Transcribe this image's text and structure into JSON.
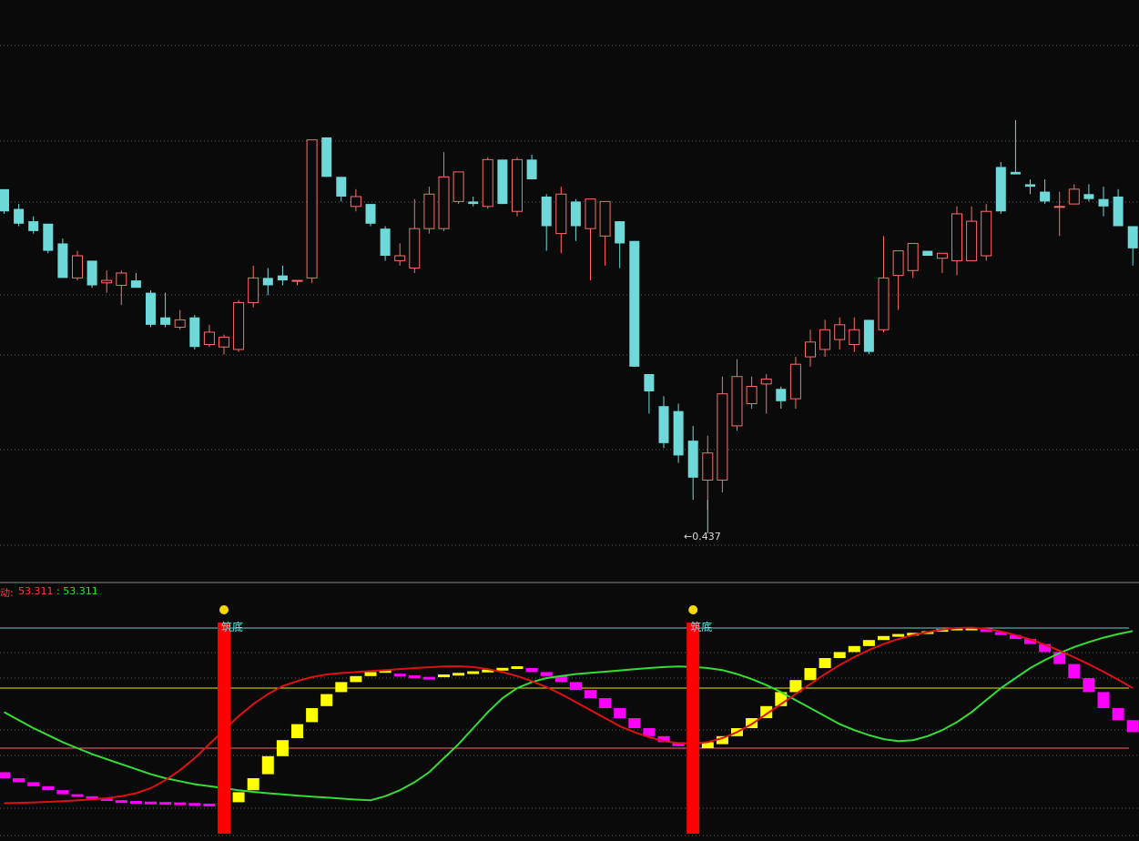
{
  "colors": {
    "background": "#0a0a0a",
    "up_candle": "#ff6b6b",
    "down_candle": "#6fd9d9",
    "grid": "#5a5a5a",
    "panel_separator": "#8a8a8a",
    "slow_line": "#33dd33",
    "fast_line": "#dd1111",
    "bar_rising": "#ffff00",
    "bar_falling": "#ff00ff",
    "signal_bar": "#ff0000",
    "signal_dot": "#ffd700",
    "signal_text": "#66e0e0",
    "ref_top": "#66cccc",
    "ref_mid": "#e6e600",
    "ref_low": "#ff6666"
  },
  "indicator": {
    "name": "动",
    "name_suffix": ":",
    "value_red": "53.311",
    "value_green": "53.311"
  },
  "price_annotation": {
    "min_label": "←0.437"
  },
  "signal_text": "筑底",
  "chart_data": [
    {
      "type": "candlestick",
      "x": [
        "c1",
        "c2",
        "c3",
        "c4",
        "c5",
        "c6",
        "c7",
        "c8",
        "c9",
        "c10",
        "c11",
        "c12",
        "c13",
        "c14",
        "c15",
        "c16",
        "c17",
        "c18",
        "c19",
        "c20",
        "c21",
        "c22",
        "c23",
        "c24",
        "c25",
        "c26",
        "c27",
        "c28",
        "c29",
        "c30",
        "c31",
        "c32",
        "c33",
        "c34",
        "c35",
        "c36",
        "c37",
        "c38",
        "c39",
        "c40",
        "c41",
        "c42",
        "c43",
        "c44",
        "c45",
        "c46",
        "c47",
        "c48",
        "c49",
        "c50",
        "c51",
        "c52",
        "c53",
        "c54",
        "c55",
        "c56",
        "c57",
        "c58",
        "c59",
        "c60",
        "c61",
        "c62",
        "c63",
        "c64",
        "c65",
        "c66",
        "c67",
        "c68",
        "c69",
        "c70",
        "c71",
        "c72",
        "c73",
        "c74",
        "c75",
        "c76",
        "c77",
        "c78"
      ],
      "ohlc": [
        [
          0.567,
          0.567,
          0.557,
          0.558
        ],
        [
          0.559,
          0.561,
          0.552,
          0.553
        ],
        [
          0.554,
          0.556,
          0.549,
          0.55
        ],
        [
          0.553,
          0.553,
          0.541,
          0.542
        ],
        [
          0.545,
          0.547,
          0.531,
          0.531
        ],
        [
          0.531,
          0.542,
          0.53,
          0.54
        ],
        [
          0.538,
          0.538,
          0.527,
          0.528
        ],
        [
          0.529,
          0.534,
          0.525,
          0.53
        ],
        [
          0.528,
          0.534,
          0.52,
          0.533
        ],
        [
          0.53,
          0.533,
          0.527,
          0.527
        ],
        [
          0.525,
          0.526,
          0.511,
          0.512
        ],
        [
          0.515,
          0.525,
          0.511,
          0.512
        ],
        [
          0.511,
          0.518,
          0.51,
          0.514
        ],
        [
          0.515,
          0.516,
          0.502,
          0.503
        ],
        [
          0.504,
          0.512,
          0.503,
          0.509
        ],
        [
          0.503,
          0.508,
          0.5,
          0.507
        ],
        [
          0.502,
          0.522,
          0.501,
          0.521
        ],
        [
          0.521,
          0.536,
          0.519,
          0.531
        ],
        [
          0.531,
          0.535,
          0.524,
          0.528
        ],
        [
          0.532,
          0.536,
          0.528,
          0.53
        ],
        [
          0.53,
          0.53,
          0.528,
          0.53
        ],
        [
          0.531,
          0.587,
          0.529,
          0.587
        ],
        [
          0.588,
          0.588,
          0.572,
          0.572
        ],
        [
          0.572,
          0.572,
          0.562,
          0.564
        ],
        [
          0.56,
          0.567,
          0.558,
          0.564
        ],
        [
          0.561,
          0.561,
          0.552,
          0.553
        ],
        [
          0.551,
          0.552,
          0.538,
          0.54
        ],
        [
          0.538,
          0.545,
          0.536,
          0.54
        ],
        [
          0.535,
          0.563,
          0.533,
          0.551
        ],
        [
          0.551,
          0.568,
          0.549,
          0.565
        ],
        [
          0.551,
          0.582,
          0.55,
          0.572
        ],
        [
          0.562,
          0.573,
          0.561,
          0.574
        ],
        [
          0.562,
          0.564,
          0.56,
          0.561
        ],
        [
          0.56,
          0.58,
          0.559,
          0.579
        ],
        [
          0.579,
          0.579,
          0.561,
          0.561
        ],
        [
          0.558,
          0.58,
          0.556,
          0.579
        ],
        [
          0.579,
          0.581,
          0.571,
          0.571
        ],
        [
          0.564,
          0.565,
          0.542,
          0.552
        ],
        [
          0.549,
          0.568,
          0.541,
          0.565
        ],
        [
          0.562,
          0.563,
          0.546,
          0.552
        ],
        [
          0.551,
          0.56,
          0.53,
          0.563
        ],
        [
          0.548,
          0.561,
          0.536,
          0.562
        ],
        [
          0.554,
          0.554,
          0.535,
          0.545
        ],
        [
          0.546,
          0.546,
          0.496,
          0.495
        ],
        [
          0.492,
          0.486,
          0.476,
          0.485
        ],
        [
          0.479,
          0.483,
          0.462,
          0.464
        ],
        [
          0.477,
          0.48,
          0.456,
          0.459
        ],
        [
          0.465,
          0.471,
          0.441,
          0.45
        ],
        [
          0.449,
          0.467,
          0.437,
          0.46
        ],
        [
          0.449,
          0.491,
          0.444,
          0.484
        ],
        [
          0.471,
          0.498,
          0.469,
          0.491
        ],
        [
          0.48,
          0.491,
          0.478,
          0.487
        ],
        [
          0.488,
          0.492,
          0.476,
          0.49
        ],
        [
          0.486,
          0.487,
          0.478,
          0.481
        ],
        [
          0.482,
          0.499,
          0.478,
          0.496
        ],
        [
          0.499,
          0.51,
          0.495,
          0.505
        ],
        [
          0.502,
          0.514,
          0.499,
          0.51
        ],
        [
          0.506,
          0.515,
          0.502,
          0.512
        ],
        [
          0.504,
          0.515,
          0.501,
          0.51
        ],
        [
          0.514,
          0.514,
          0.5,
          0.501
        ],
        [
          0.51,
          0.548,
          0.509,
          0.531
        ],
        [
          0.532,
          0.541,
          0.518,
          0.542
        ],
        [
          0.534,
          0.545,
          0.531,
          0.545
        ],
        [
          0.542,
          0.542,
          0.54,
          0.54
        ],
        [
          0.539,
          0.541,
          0.533,
          0.541
        ],
        [
          0.538,
          0.56,
          0.532,
          0.557
        ],
        [
          0.538,
          0.56,
          0.538,
          0.554
        ],
        [
          0.54,
          0.561,
          0.538,
          0.558
        ],
        [
          0.576,
          0.578,
          0.557,
          0.558
        ],
        [
          0.574,
          0.595,
          0.573,
          0.573
        ],
        [
          0.569,
          0.571,
          0.565,
          0.568
        ],
        [
          0.566,
          0.571,
          0.561,
          0.562
        ],
        [
          0.56,
          0.566,
          0.548,
          0.56
        ],
        [
          0.561,
          0.569,
          0.561,
          0.567
        ],
        [
          0.565,
          0.569,
          0.562,
          0.563
        ],
        [
          0.563,
          0.568,
          0.556,
          0.56
        ],
        [
          0.564,
          0.567,
          0.552,
          0.552
        ],
        [
          0.552,
          0.542,
          0.536,
          0.543
        ]
      ],
      "min_price": 0.437
    },
    {
      "type": "bar+line",
      "x": [
        "c1",
        "c2",
        "c3",
        "c4",
        "c5",
        "c6",
        "c7",
        "c8",
        "c9",
        "c10",
        "c11",
        "c12",
        "c13",
        "c14",
        "c15",
        "c16",
        "c17",
        "c18",
        "c19",
        "c20",
        "c21",
        "c22",
        "c23",
        "c24",
        "c25",
        "c26",
        "c27",
        "c28",
        "c29",
        "c30",
        "c31",
        "c32",
        "c33",
        "c34",
        "c35",
        "c36",
        "c37",
        "c38",
        "c39",
        "c40",
        "c41",
        "c42",
        "c43",
        "c44",
        "c45",
        "c46",
        "c47",
        "c48",
        "c49",
        "c50",
        "c51",
        "c52",
        "c53",
        "c54",
        "c55",
        "c56",
        "c57",
        "c58",
        "c59",
        "c60",
        "c61",
        "c62",
        "c63",
        "c64",
        "c65",
        "c66",
        "c67",
        "c68",
        "c69",
        "c70",
        "c71",
        "c72",
        "c73",
        "c74",
        "c75",
        "c76",
        "c77",
        "c78"
      ],
      "ylim": [
        0,
        100
      ],
      "reference_lines": [
        90,
        60,
        30
      ],
      "bars": [
        {
          "from": 15,
          "to": 18
        },
        {
          "from": 13,
          "to": 15
        },
        {
          "from": 11,
          "to": 13
        },
        {
          "from": 9,
          "to": 11
        },
        {
          "from": 7,
          "to": 9
        },
        {
          "from": 6,
          "to": 7
        },
        {
          "from": 5,
          "to": 6
        },
        {
          "from": 4,
          "to": 5
        },
        {
          "from": 3.6,
          "to": 4
        },
        {
          "from": 3.3,
          "to": 3.6
        },
        {
          "from": 3.1,
          "to": 3.3
        },
        {
          "from": 2.9,
          "to": 3.1
        },
        {
          "from": 2.6,
          "to": 2.9
        },
        {
          "from": 2.3,
          "to": 2.6
        },
        {
          "from": 2.2,
          "to": 2.3
        },
        {
          "from": 2.1,
          "to": 2.2
        },
        {
          "from": 3,
          "to": 8
        },
        {
          "from": 9,
          "to": 15
        },
        {
          "from": 17,
          "to": 26
        },
        {
          "from": 26,
          "to": 34
        },
        {
          "from": 35,
          "to": 42
        },
        {
          "from": 43,
          "to": 50
        },
        {
          "from": 51,
          "to": 57
        },
        {
          "from": 58,
          "to": 63
        },
        {
          "from": 63,
          "to": 66
        },
        {
          "from": 66,
          "to": 68
        },
        {
          "from": 68,
          "to": 69
        },
        {
          "from": 66.3,
          "to": 67.2
        },
        {
          "from": 65.6,
          "to": 66.3
        },
        {
          "from": 64.7,
          "to": 65.6
        },
        {
          "from": 65.5,
          "to": 66.8
        },
        {
          "from": 66.8,
          "to": 67.6
        },
        {
          "from": 67.6,
          "to": 68.4
        },
        {
          "from": 68.4,
          "to": 69.2
        },
        {
          "from": 69.2,
          "to": 70.1
        },
        {
          "from": 70.1,
          "to": 70.9
        },
        {
          "from": 68,
          "to": 70
        },
        {
          "from": 66,
          "to": 68
        },
        {
          "from": 63,
          "to": 66
        },
        {
          "from": 59,
          "to": 63
        },
        {
          "from": 55,
          "to": 59
        },
        {
          "from": 50,
          "to": 55
        },
        {
          "from": 45,
          "to": 50
        },
        {
          "from": 40,
          "to": 45
        },
        {
          "from": 36,
          "to": 40
        },
        {
          "from": 33,
          "to": 36
        },
        {
          "from": 31,
          "to": 33
        },
        {
          "from": 29,
          "to": 31
        },
        {
          "from": 30,
          "to": 33
        },
        {
          "from": 32,
          "to": 36
        },
        {
          "from": 36,
          "to": 40
        },
        {
          "from": 40,
          "to": 45
        },
        {
          "from": 45,
          "to": 51
        },
        {
          "from": 51,
          "to": 58
        },
        {
          "from": 58,
          "to": 64
        },
        {
          "from": 64,
          "to": 70
        },
        {
          "from": 70,
          "to": 75
        },
        {
          "from": 75,
          "to": 78
        },
        {
          "from": 78,
          "to": 81
        },
        {
          "from": 81,
          "to": 84
        },
        {
          "from": 84,
          "to": 86
        },
        {
          "from": 86,
          "to": 87
        },
        {
          "from": 87,
          "to": 87.6
        },
        {
          "from": 87.6,
          "to": 88.4
        },
        {
          "from": 88.4,
          "to": 89.5
        },
        {
          "from": 89.5,
          "to": 90.2
        },
        {
          "from": 89.8,
          "to": 90.2
        },
        {
          "from": 88,
          "to": 89.8
        },
        {
          "from": 86.5,
          "to": 88
        },
        {
          "from": 84.5,
          "to": 86.5
        },
        {
          "from": 82,
          "to": 84.5
        },
        {
          "from": 78,
          "to": 82
        },
        {
          "from": 72,
          "to": 78
        },
        {
          "from": 65,
          "to": 72
        },
        {
          "from": 58,
          "to": 65
        },
        {
          "from": 50,
          "to": 58
        },
        {
          "from": 44,
          "to": 50
        },
        {
          "from": 38,
          "to": 44
        }
      ],
      "slow_line": [
        48,
        44,
        40,
        36.5,
        33,
        30,
        27,
        24.5,
        22,
        19.5,
        17,
        15,
        13.5,
        12,
        11,
        10,
        9,
        8.2,
        7.5,
        6.9,
        6.3,
        5.8,
        5.3,
        4.8,
        4.3,
        4,
        6,
        9,
        13,
        18,
        25,
        32,
        40,
        48,
        55,
        60,
        63,
        65,
        66,
        67,
        67.6,
        68.2,
        68.8,
        69.4,
        70,
        70.5,
        70.8,
        70.6,
        70,
        69,
        67,
        64.5,
        61.5,
        58,
        54,
        50,
        46,
        42,
        39,
        36.5,
        34.5,
        33.5,
        34,
        36,
        39,
        43,
        48,
        54,
        60,
        65,
        70,
        74,
        77.5,
        80.5,
        83,
        85.2,
        87,
        88.5
      ],
      "fast_line": [
        2.5,
        2.7,
        2.9,
        3.2,
        3.5,
        3.9,
        4.4,
        5,
        6,
        7.5,
        10,
        14,
        19,
        25,
        32,
        39,
        46,
        52,
        57,
        61,
        63.5,
        65.5,
        66.8,
        67.5,
        68,
        68.5,
        69,
        69.5,
        70,
        70.4,
        70.8,
        70.9,
        70.5,
        69.5,
        68,
        66,
        63.5,
        60.5,
        57,
        53,
        49,
        45,
        41,
        38,
        35.5,
        33.5,
        32.5,
        32.3,
        33,
        35,
        38,
        42,
        47,
        52,
        57,
        62,
        67,
        71.5,
        75.5,
        79,
        82,
        84.5,
        86.5,
        88,
        89.2,
        90,
        90.2,
        89.6,
        88.3,
        86.5,
        84.3,
        81.7,
        78.7,
        75.4,
        71.9,
        68.2,
        64.2,
        60
      ],
      "signals": [
        {
          "index": 15,
          "label": "筑底"
        },
        {
          "index": 47,
          "label": "筑底"
        }
      ]
    }
  ]
}
